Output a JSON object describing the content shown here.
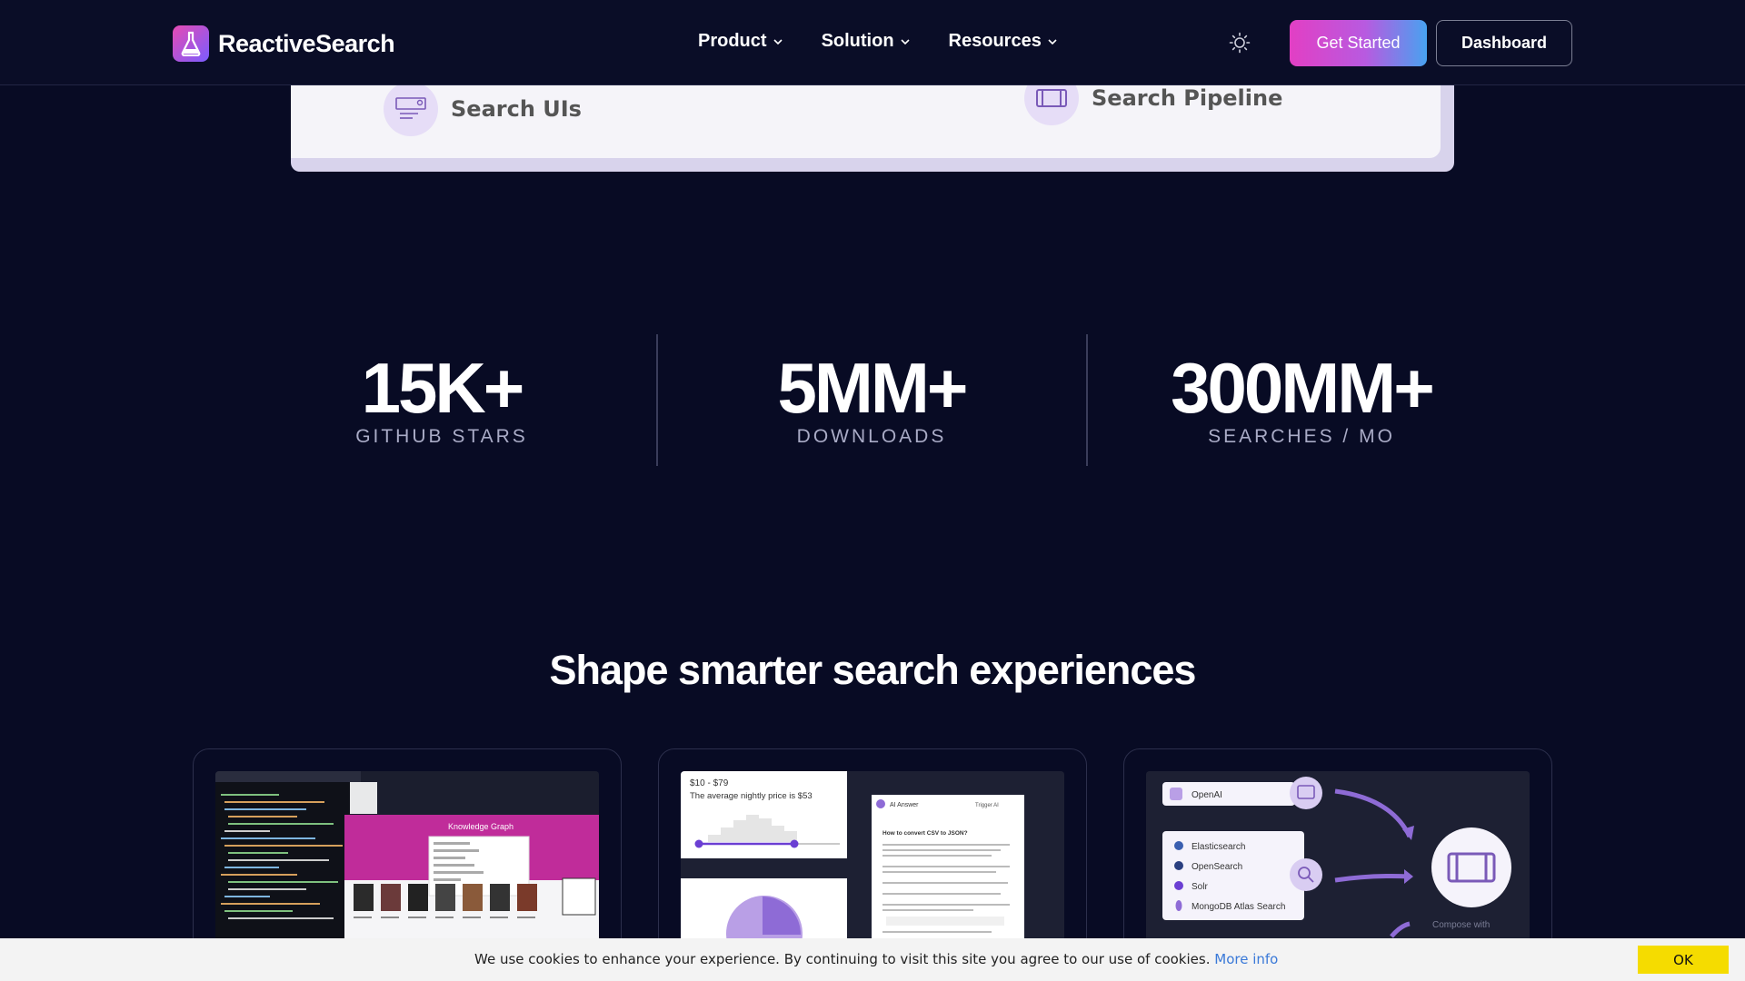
{
  "header": {
    "brand": "ReactiveSearch",
    "nav": [
      {
        "label": "Product"
      },
      {
        "label": "Solution"
      },
      {
        "label": "Resources"
      }
    ],
    "theme_icon": "sun-icon",
    "get_started_label": "Get Started",
    "dashboard_label": "Dashboard"
  },
  "features": {
    "search_uis": "Search UIs",
    "search_pipeline": "Search Pipeline"
  },
  "stats": [
    {
      "value": "15K+",
      "label": "GITHUB STARS"
    },
    {
      "value": "5MM+",
      "label": "DOWNLOADS"
    },
    {
      "value": "300MM+",
      "label": "SEARCHES / MO"
    }
  ],
  "section_title": "Shape smarter search experiences",
  "cards": {
    "card1": {
      "title": "Knowledge Graph"
    },
    "card2": {
      "price_range": "$10 - $79",
      "price_note": "The average nightly price is $53",
      "ai_title": "AI Answer",
      "ai_question": "How to convert CSV to JSON?",
      "ai_tag": "Trigger AI"
    },
    "card3": {
      "llm": "OpenAI",
      "engines": [
        "Elasticsearch",
        "OpenSearch",
        "Solr",
        "MongoDB Atlas Search"
      ],
      "compose": "Compose with"
    }
  },
  "cookie": {
    "text": "We use cookies to enhance your experience. By continuing to visit this site you agree to our use of cookies.",
    "link": "More info",
    "ok": "OK"
  },
  "colors": {
    "background": "#080b24",
    "accent_pink": "#e23fc4",
    "accent_blue": "#48a2f0",
    "accent_purple": "#7a5cff",
    "cookie_button": "#f5dc00"
  }
}
